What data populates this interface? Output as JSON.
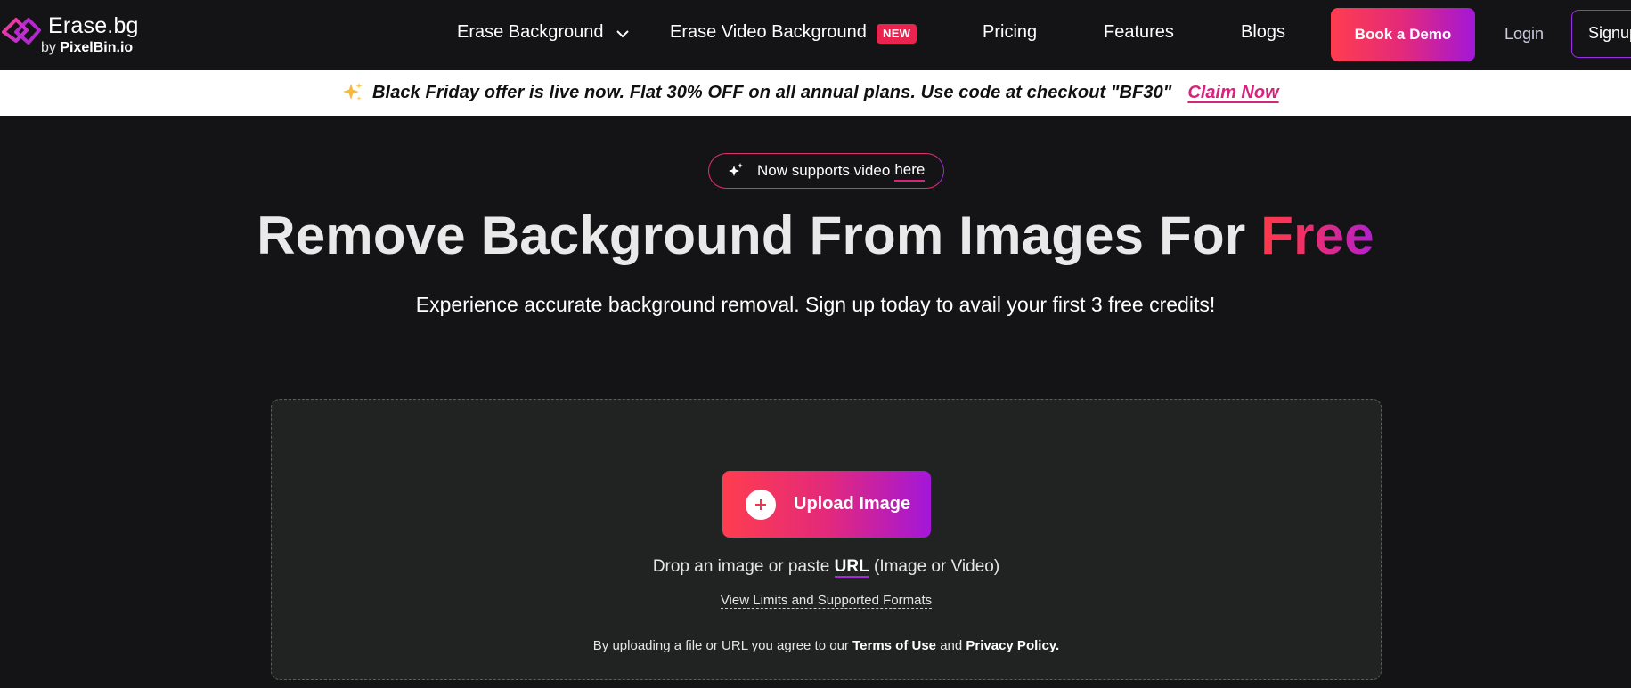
{
  "brand": {
    "name": "Erase.bg",
    "byline_prefix": "by",
    "byline_company": "PixelBin.io"
  },
  "nav": {
    "items": [
      {
        "label": "Erase Background"
      },
      {
        "label": "Erase Video Background",
        "badge": "NEW"
      },
      {
        "label": "Pricing"
      },
      {
        "label": "Features"
      },
      {
        "label": "Blogs"
      }
    ],
    "book_demo": "Book a Demo",
    "login": "Login",
    "signup": "Signup"
  },
  "banner": {
    "text": "Black Friday offer is live now. Flat 30% OFF on all annual plans. Use code at checkout \"BF30\"",
    "link": "Claim Now"
  },
  "hero": {
    "pill_text": "Now supports video",
    "pill_link": "here",
    "title_main": "Remove Background From Images For",
    "title_accent": "Free",
    "subtitle": "Experience accurate background removal. Sign up today to avail your first 3 free credits!"
  },
  "upload": {
    "button": "Upload Image",
    "drop_prefix": "Drop an image or paste",
    "drop_link": "URL",
    "drop_suffix": "(Image or Video)",
    "limits_link": "View Limits and Supported Formats",
    "terms_prefix": "By uploading a file or URL you agree to our",
    "terms_link": "Terms of Use",
    "terms_and": "and",
    "privacy_link": "Privacy Policy."
  },
  "colors": {
    "background": "#141416",
    "dropzone": "#212222",
    "accent_pink": "#e8244f",
    "accent_purple": "#a317d9",
    "link_pink": "#d6247c"
  },
  "icons": {
    "logo": "erase-bg-logo-icon",
    "chevron": "chevron-down-icon",
    "sparkle_banner": "sparkle-emoji-icon",
    "sparkle_pill": "sparkles-icon",
    "plus": "plus-circle-icon"
  }
}
